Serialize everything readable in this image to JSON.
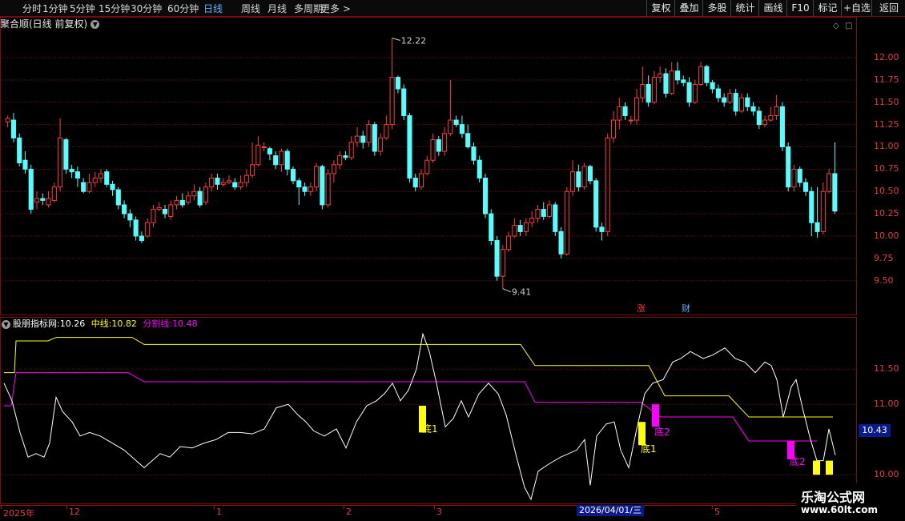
{
  "toolbar": {
    "periods": [
      "分时",
      "1分钟",
      "5分钟",
      "15分钟",
      "30分钟",
      "60分钟",
      "日线",
      "周线",
      "月线",
      "多周期",
      "更多 >"
    ],
    "active_period": "日线",
    "buttons": [
      "复权",
      "叠加",
      "多股",
      "统计",
      "画线",
      "F10",
      "标记",
      "+自选",
      "返回"
    ]
  },
  "stock": {
    "title": "聚合顺(日线 前复权)"
  },
  "upper_axis": [
    "12.00",
    "11.75",
    "11.50",
    "11.25",
    "11.00",
    "10.75",
    "10.50",
    "10.25",
    "10.00",
    "9.75",
    "9.50"
  ],
  "price_annotations": {
    "high": "12.22",
    "low": "9.41"
  },
  "badges": {
    "zhang": "涨",
    "cai": "财"
  },
  "indicator": {
    "name": "股朋指标网",
    "main_label": "股朋指标网",
    "main_value": ":10.26",
    "mid_label": "中线:",
    "mid_value": "10.82",
    "split_label": "分割线:",
    "split_value": "10.48",
    "signals": [
      "底1",
      "底2",
      "底1",
      "底2"
    ]
  },
  "lower_axis": [
    "11.50",
    "11.00",
    "10.00"
  ],
  "current_price": "10.43",
  "dates": {
    "labels": [
      "2025年",
      "12",
      "1",
      "2",
      "3",
      "4",
      "5"
    ],
    "crosshair": "2026/04/01/三"
  },
  "watermark": {
    "line1": "乐淘公式网",
    "line2": "www.60lt.com"
  },
  "colors": {
    "up": "#ff3c3c",
    "down": "#54ffff",
    "mid_line": "#ffff00",
    "split_line": "#ff00ff",
    "main_line": "#ffffff",
    "grid": "#7a0d0d"
  },
  "chart_data": {
    "type": "candlestick",
    "ylim": [
      9.3,
      12.35
    ],
    "candles": [
      [
        11.28,
        11.32,
        11.35,
        11.22
      ],
      [
        11.3,
        11.1,
        11.38,
        11.05
      ],
      [
        11.1,
        10.82,
        11.15,
        10.78
      ],
      [
        10.85,
        10.75,
        10.95,
        10.7
      ],
      [
        10.75,
        10.3,
        10.8,
        10.25
      ],
      [
        10.38,
        10.42,
        10.5,
        10.3
      ],
      [
        10.42,
        10.4,
        10.48,
        10.35
      ],
      [
        10.35,
        10.42,
        10.5,
        10.32
      ],
      [
        10.4,
        10.55,
        10.6,
        10.38
      ],
      [
        10.55,
        11.1,
        11.32,
        10.5
      ],
      [
        11.08,
        10.75,
        11.1,
        10.7
      ],
      [
        10.75,
        10.72,
        10.8,
        10.65
      ],
      [
        10.72,
        10.65,
        10.78,
        10.55
      ],
      [
        10.6,
        10.5,
        10.65,
        10.48
      ],
      [
        10.5,
        10.6,
        10.7,
        10.48
      ],
      [
        10.6,
        10.65,
        10.72,
        10.55
      ],
      [
        10.65,
        10.7,
        10.75,
        10.6
      ],
      [
        10.72,
        10.58,
        10.75,
        10.55
      ],
      [
        10.58,
        10.52,
        10.62,
        10.45
      ],
      [
        10.52,
        10.35,
        10.55,
        10.3
      ],
      [
        10.35,
        10.25,
        10.4,
        10.2
      ],
      [
        10.25,
        10.18,
        10.3,
        10.1
      ],
      [
        10.18,
        10.0,
        10.22,
        9.95
      ],
      [
        10.0,
        9.95,
        10.05,
        9.92
      ],
      [
        10.0,
        10.15,
        10.2,
        9.98
      ],
      [
        10.15,
        10.3,
        10.35,
        10.1
      ],
      [
        10.3,
        10.32,
        10.38,
        10.28
      ],
      [
        10.3,
        10.25,
        10.35,
        10.2
      ],
      [
        10.22,
        10.35,
        10.4,
        10.18
      ],
      [
        10.35,
        10.4,
        10.45,
        10.3
      ],
      [
        10.4,
        10.35,
        10.48,
        10.32
      ],
      [
        10.38,
        10.45,
        10.5,
        10.35
      ],
      [
        10.45,
        10.5,
        10.58,
        10.4
      ],
      [
        10.5,
        10.35,
        10.55,
        10.32
      ],
      [
        10.38,
        10.55,
        10.6,
        10.35
      ],
      [
        10.55,
        10.65,
        10.7,
        10.5
      ],
      [
        10.65,
        10.58,
        10.7,
        10.52
      ],
      [
        10.58,
        10.6,
        10.65,
        10.55
      ],
      [
        10.6,
        10.62,
        10.68,
        10.58
      ],
      [
        10.6,
        10.55,
        10.65,
        10.52
      ],
      [
        10.55,
        10.6,
        10.68,
        10.52
      ],
      [
        10.6,
        10.68,
        10.75,
        10.55
      ],
      [
        10.68,
        10.8,
        11.05,
        10.65
      ],
      [
        10.8,
        11.02,
        11.12,
        10.78
      ],
      [
        11.0,
        11.0,
        11.05,
        10.95
      ],
      [
        10.98,
        10.92,
        11.0,
        10.85
      ],
      [
        10.9,
        10.8,
        10.95,
        10.75
      ],
      [
        10.8,
        10.95,
        10.98,
        10.72
      ],
      [
        10.95,
        10.75,
        10.98,
        10.68
      ],
      [
        10.75,
        10.62,
        10.78,
        10.58
      ],
      [
        10.62,
        10.55,
        10.65,
        10.35
      ],
      [
        10.55,
        10.5,
        10.6,
        10.45
      ],
      [
        10.5,
        10.55,
        10.6,
        10.45
      ],
      [
        10.55,
        10.78,
        10.82,
        10.5
      ],
      [
        10.78,
        10.35,
        10.8,
        10.3
      ],
      [
        10.35,
        10.7,
        10.75,
        10.32
      ],
      [
        10.7,
        10.8,
        10.85,
        10.6
      ],
      [
        10.8,
        10.9,
        10.95,
        10.75
      ],
      [
        10.9,
        10.88,
        10.95,
        10.85
      ],
      [
        10.88,
        11.05,
        11.12,
        10.85
      ],
      [
        11.05,
        11.12,
        11.22,
        11.0
      ],
      [
        11.12,
        11.05,
        11.18,
        10.98
      ],
      [
        11.05,
        11.25,
        11.3,
        11.0
      ],
      [
        11.25,
        10.95,
        11.28,
        10.9
      ],
      [
        10.95,
        11.1,
        11.15,
        10.9
      ],
      [
        11.1,
        11.25,
        11.35,
        11.08
      ],
      [
        11.25,
        11.78,
        12.22,
        11.2
      ],
      [
        11.78,
        11.65,
        11.8,
        11.6
      ],
      [
        11.65,
        11.35,
        11.7,
        11.3
      ],
      [
        11.35,
        10.65,
        11.38,
        10.6
      ],
      [
        10.65,
        10.55,
        10.7,
        10.5
      ],
      [
        10.55,
        10.7,
        10.75,
        10.52
      ],
      [
        10.7,
        10.85,
        10.9,
        10.68
      ],
      [
        10.85,
        11.08,
        11.15,
        10.82
      ],
      [
        11.08,
        10.95,
        11.12,
        10.9
      ],
      [
        10.95,
        11.15,
        11.22,
        10.9
      ],
      [
        11.15,
        11.3,
        11.75,
        11.12
      ],
      [
        11.3,
        11.25,
        11.35,
        11.22
      ],
      [
        11.25,
        11.15,
        11.35,
        11.1
      ],
      [
        11.15,
        11.0,
        11.25,
        10.98
      ],
      [
        11.0,
        10.85,
        11.05,
        10.8
      ],
      [
        10.85,
        10.65,
        10.9,
        10.6
      ],
      [
        10.65,
        10.25,
        10.7,
        10.2
      ],
      [
        10.25,
        9.95,
        10.3,
        9.9
      ],
      [
        9.95,
        9.55,
        10.0,
        9.5
      ],
      [
        9.55,
        9.85,
        9.9,
        9.41
      ],
      [
        9.85,
        10.0,
        10.05,
        9.82
      ],
      [
        10.0,
        10.12,
        10.2,
        9.98
      ],
      [
        10.12,
        10.05,
        10.18,
        10.0
      ],
      [
        10.05,
        10.15,
        10.2,
        10.0
      ],
      [
        10.15,
        10.2,
        10.28,
        10.1
      ],
      [
        10.2,
        10.3,
        10.35,
        10.15
      ],
      [
        10.3,
        10.22,
        10.38,
        10.18
      ],
      [
        10.22,
        10.35,
        10.4,
        10.2
      ],
      [
        10.35,
        10.05,
        10.38,
        10.0
      ],
      [
        10.05,
        9.8,
        10.1,
        9.75
      ],
      [
        9.8,
        10.5,
        10.55,
        9.78
      ],
      [
        10.5,
        10.72,
        10.85,
        10.45
      ],
      [
        10.72,
        10.55,
        10.8,
        10.5
      ],
      [
        10.55,
        10.78,
        10.82,
        10.52
      ],
      [
        10.78,
        10.62,
        10.8,
        10.58
      ],
      [
        10.62,
        10.1,
        10.65,
        10.05
      ],
      [
        10.1,
        10.05,
        10.15,
        9.95
      ],
      [
        10.05,
        11.1,
        11.15,
        10.0
      ],
      [
        11.1,
        11.3,
        11.4,
        11.05
      ],
      [
        11.3,
        11.45,
        11.55,
        11.2
      ],
      [
        11.45,
        11.35,
        11.5,
        11.3
      ],
      [
        11.3,
        11.3,
        11.35,
        11.25
      ],
      [
        11.3,
        11.55,
        11.65,
        11.25
      ],
      [
        11.55,
        11.7,
        11.9,
        11.5
      ],
      [
        11.7,
        11.5,
        11.8,
        11.45
      ],
      [
        11.5,
        11.78,
        11.85,
        11.48
      ],
      [
        11.78,
        11.82,
        11.9,
        11.72
      ],
      [
        11.82,
        11.6,
        11.88,
        11.55
      ],
      [
        11.6,
        11.85,
        11.95,
        11.58
      ],
      [
        11.85,
        11.75,
        11.95,
        11.7
      ],
      [
        11.75,
        11.72,
        11.8,
        11.68
      ],
      [
        11.72,
        11.5,
        11.78,
        11.45
      ],
      [
        11.5,
        11.7,
        11.75,
        11.48
      ],
      [
        11.7,
        11.9,
        11.95,
        11.68
      ],
      [
        11.9,
        11.72,
        11.92,
        11.68
      ],
      [
        11.72,
        11.65,
        11.75,
        11.6
      ],
      [
        11.65,
        11.55,
        11.7,
        11.5
      ],
      [
        11.55,
        11.5,
        11.6,
        11.45
      ],
      [
        11.5,
        11.6,
        11.65,
        11.48
      ],
      [
        11.6,
        11.4,
        11.65,
        11.35
      ],
      [
        11.4,
        11.55,
        11.6,
        11.38
      ],
      [
        11.55,
        11.45,
        11.6,
        11.4
      ],
      [
        11.45,
        11.4,
        11.5,
        11.35
      ],
      [
        11.4,
        11.25,
        11.45,
        11.2
      ],
      [
        11.25,
        11.3,
        11.35,
        11.22
      ],
      [
        11.3,
        11.35,
        11.45,
        11.28
      ],
      [
        11.35,
        11.45,
        11.58,
        11.3
      ],
      [
        11.45,
        11.0,
        11.5,
        10.95
      ],
      [
        11.0,
        10.55,
        11.05,
        10.5
      ],
      [
        10.55,
        10.75,
        10.8,
        10.5
      ],
      [
        10.75,
        10.6,
        10.78,
        10.55
      ],
      [
        10.6,
        10.5,
        10.65,
        10.45
      ],
      [
        10.5,
        10.15,
        10.55,
        10.0
      ],
      [
        10.15,
        10.05,
        10.55,
        9.98
      ],
      [
        10.05,
        10.5,
        10.6,
        10.02
      ],
      [
        10.5,
        10.7,
        10.75,
        10.48
      ],
      [
        10.7,
        10.28,
        11.05,
        10.25
      ]
    ]
  }
}
